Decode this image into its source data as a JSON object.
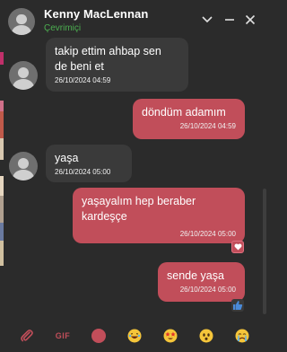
{
  "header": {
    "name": "Kenny MacLennan",
    "status": "Çevrimiçi",
    "status_color": "#4caf50"
  },
  "messages": [
    {
      "direction": "in",
      "text": "takip ettim ahbap sen\nde beni et",
      "time": "26/10/2024 04:59"
    },
    {
      "direction": "out",
      "text": "döndüm adamım",
      "time": "26/10/2024 04:59"
    },
    {
      "direction": "in",
      "text": "yaşa",
      "time": "26/10/2024 05:00"
    },
    {
      "direction": "out",
      "text": "yaşayalım hep beraber\nkardeşçe",
      "time": "26/10/2024 05:00",
      "reaction": "heart-icon"
    },
    {
      "direction": "out",
      "text": "sende yaşa",
      "time": "26/10/2024 05:00",
      "reaction": "thumbs-up-icon"
    }
  ],
  "toolbar": {
    "gif_label": "GIF",
    "items": [
      "attach-icon",
      "gif-button",
      "record-icon",
      "laughing-emoji",
      "star-eyes-emoji",
      "heart-eyes-emoji",
      "surprised-emoji",
      "crying-emoji"
    ]
  },
  "colors": {
    "background": "#2b2b2b",
    "incoming_bubble": "#3a3a3a",
    "outgoing_bubble": "#c14e5a",
    "accent": "#c14e5a"
  }
}
